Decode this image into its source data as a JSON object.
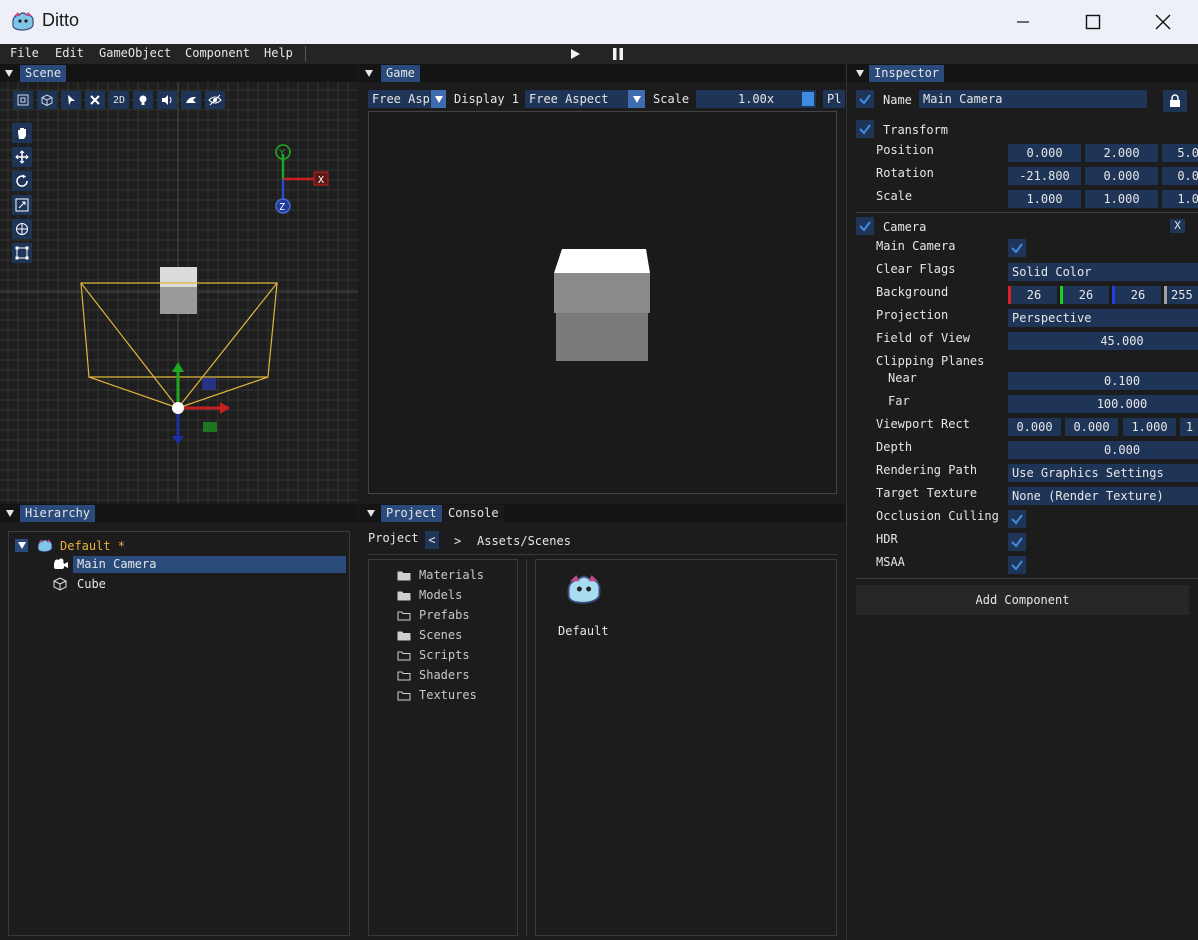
{
  "window": {
    "title": "Ditto"
  },
  "menu": {
    "items": [
      "File",
      "Edit",
      "GameObject",
      "Component",
      "Help"
    ]
  },
  "scene_panel": {
    "tab": "Scene",
    "toolbar_2d_label": "2D"
  },
  "game_panel": {
    "tab": "Game",
    "aspect_dropdown": "Free Asp",
    "display_label": "Display 1",
    "aspect_select": "Free Aspect",
    "scale_label": "Scale",
    "scale_value": "1.00x",
    "play_button_label": "Pl"
  },
  "hierarchy_panel": {
    "tab": "Hierarchy",
    "scene_name": "Default *",
    "items": [
      "Main Camera",
      "Cube"
    ]
  },
  "project_panel": {
    "tabs": [
      "Project",
      "Console"
    ],
    "nav_label": "Project",
    "back_label": "<",
    "forward_label": ">",
    "path": "Assets/Scenes",
    "folders": [
      "Materials",
      "Models",
      "Prefabs",
      "Scenes",
      "Scripts",
      "Shaders",
      "Textures"
    ],
    "asset_name": "Default"
  },
  "inspector_panel": {
    "tab": "Inspector",
    "name_label": "Name",
    "name_value": "Main Camera",
    "transform": {
      "header": "Transform",
      "position_label": "Position",
      "position": [
        "0.000",
        "2.000",
        "5.0"
      ],
      "rotation_label": "Rotation",
      "rotation": [
        "-21.800",
        "0.000",
        "0.0"
      ],
      "scale_label": "Scale",
      "scale": [
        "1.000",
        "1.000",
        "1.0"
      ]
    },
    "camera": {
      "header": "Camera",
      "remove_label": "X",
      "main_camera_label": "Main Camera",
      "clear_flags_label": "Clear Flags",
      "clear_flags_value": "Solid Color",
      "background_label": "Background",
      "background": [
        "26",
        "26",
        "26",
        "255"
      ],
      "projection_label": "Projection",
      "projection_value": "Perspective",
      "fov_label": "Field of View",
      "fov_value": "45.000",
      "clipping_label": "Clipping Planes",
      "near_label": "Near",
      "near_value": "0.100",
      "far_label": "Far",
      "far_value": "100.000",
      "viewport_label": "Viewport Rect",
      "viewport": [
        "0.000",
        "0.000",
        "1.000",
        "1"
      ],
      "depth_label": "Depth",
      "depth_value": "0.000",
      "rendering_path_label": "Rendering Path",
      "rendering_path_value": "Use Graphics Settings",
      "target_texture_label": "Target Texture",
      "target_texture_value": "None (Render Texture)",
      "occlusion_label": "Occlusion Culling",
      "hdr_label": "HDR",
      "msaa_label": "MSAA"
    },
    "add_component_label": "Add Component"
  },
  "colors": {
    "accent": "#294a7a",
    "field_bg": "#1f3558",
    "check": "#3f8ce0",
    "camera_frustum": "#e2b43c",
    "scene_title_yellow": "#e8b33c"
  }
}
